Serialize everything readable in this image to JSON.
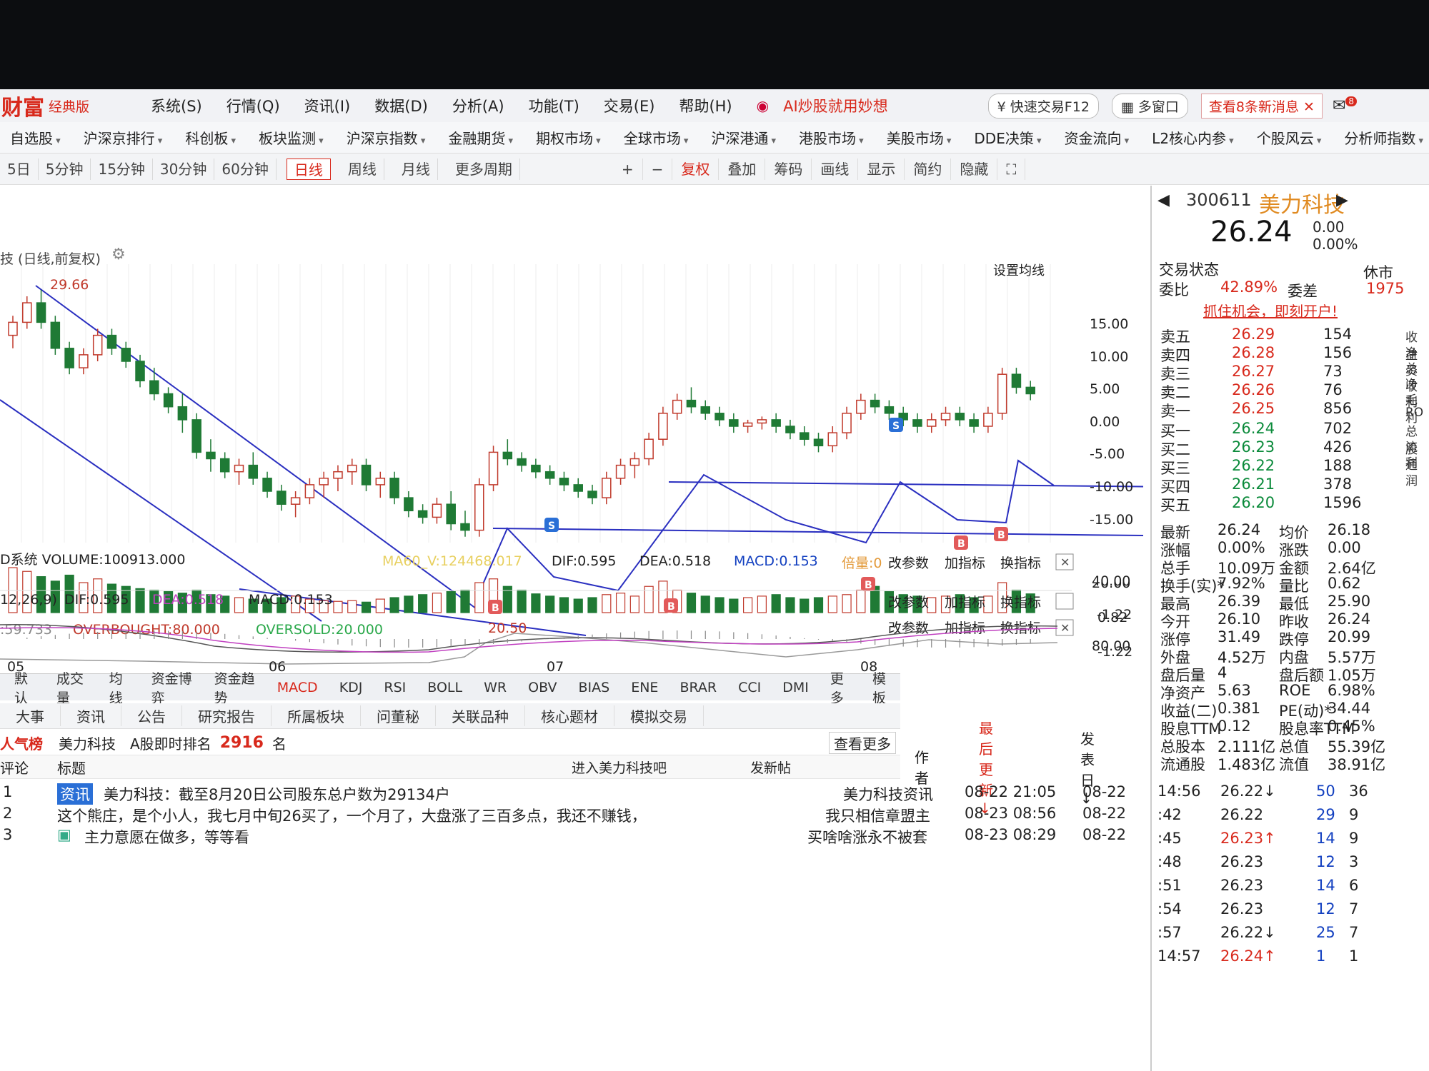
{
  "menu": {
    "logo": "财富",
    "logo_sub": "经典版",
    "items": [
      "系统(S)",
      "行情(Q)",
      "资讯(I)",
      "数据(D)",
      "分析(A)",
      "功能(T)",
      "交易(E)",
      "帮助(H)"
    ],
    "ai": "AI炒股就用妙想",
    "quick": "快速交易F12",
    "multi": "多窗口",
    "news": "查看8条新消息",
    "badge": "8"
  },
  "markets": [
    "自选股",
    "沪深京排行",
    "科创板",
    "板块监测",
    "沪深京指数",
    "金融期货",
    "期权市场",
    "全球市场",
    "沪深港通",
    "港股市场",
    "美股市场",
    "DDE决策",
    "资金流向",
    "L2核心内参",
    "个股风云",
    "分析师指数"
  ],
  "periods": [
    "5日",
    "5分钟",
    "15分钟",
    "30分钟",
    "60分钟",
    "日线",
    "周线",
    "月线",
    "更多周期"
  ],
  "tools": [
    "+",
    "−",
    "复权",
    "叠加",
    "筹码",
    "画线",
    "显示",
    "简约",
    "隐藏"
  ],
  "chart": {
    "title": "技 (日线,前复权)",
    "set_ma": "设置均线",
    "high_mark": "29.66",
    "low_mark": "20.50",
    "yticks": [
      "15.00",
      "10.00",
      "5.00",
      "0.00",
      "-5.00",
      "-10.00",
      "-15.00"
    ],
    "vol_header": "D系统 VOLUME:100913.000",
    "vol_ma": "MA60_V:124468.017",
    "vol_dif": "DIF:0.595",
    "vol_dea": "DEA:0.518",
    "vol_macd": "MACD:0.153",
    "vol_bei": "倍量:0",
    "vol_y": [
      "40.00",
      "-1.22"
    ],
    "rsi_val": ":59.733",
    "overbought": "OVERBOUGHT:80.000",
    "oversold": "OVERSOLD:20.000",
    "rsi_y": [
      "80.00",
      "20.00"
    ],
    "macd_param": "12,26,9)",
    "macd_dif": "DIF:0.595",
    "macd_dea": "DEA:0.518",
    "macd_macd": "MACD:0.153",
    "macd_y": [
      "0.82",
      "-1.22"
    ],
    "panel_btns": [
      "改参数",
      "加指标",
      "换指标"
    ],
    "months": [
      "05",
      "06",
      "07",
      "08"
    ]
  },
  "chart_data": {
    "type": "candlestick",
    "title": "",
    "xlabel": "",
    "ylabel": "",
    "ylim": [
      -17,
      19
    ],
    "annotations": {
      "high": 29.66,
      "low": 20.5,
      "buy_signals": 5,
      "sell_signals": 2
    },
    "candles": [
      [
        14,
        17,
        12,
        16
      ],
      [
        16,
        20,
        15,
        19
      ],
      [
        19,
        21,
        15,
        16
      ],
      [
        16,
        17,
        11,
        12
      ],
      [
        12,
        13,
        8,
        9
      ],
      [
        9,
        12,
        8,
        11
      ],
      [
        11,
        15,
        10,
        14
      ],
      [
        14,
        15,
        11,
        12
      ],
      [
        12,
        13,
        9,
        10
      ],
      [
        10,
        11,
        6,
        7
      ],
      [
        7,
        9,
        4,
        5
      ],
      [
        5,
        6,
        2,
        3
      ],
      [
        3,
        5,
        -1,
        1
      ],
      [
        1,
        2,
        -5,
        -4
      ],
      [
        -4,
        -2,
        -7,
        -5
      ],
      [
        -5,
        -4,
        -8,
        -7
      ],
      [
        -7,
        -5,
        -9,
        -6
      ],
      [
        -6,
        -4,
        -9,
        -8
      ],
      [
        -8,
        -7,
        -11,
        -10
      ],
      [
        -10,
        -9,
        -13,
        -12
      ],
      [
        -12,
        -10,
        -14,
        -11
      ],
      [
        -11,
        -8,
        -12,
        -9
      ],
      [
        -9,
        -7,
        -11,
        -8
      ],
      [
        -8,
        -6,
        -10,
        -7
      ],
      [
        -7,
        -5,
        -9,
        -6
      ],
      [
        -6,
        -5,
        -10,
        -9
      ],
      [
        -9,
        -7,
        -11,
        -8
      ],
      [
        -8,
        -7,
        -12,
        -11
      ],
      [
        -11,
        -10,
        -14,
        -13
      ],
      [
        -13,
        -12,
        -15,
        -14
      ],
      [
        -14,
        -11,
        -15,
        -12
      ],
      [
        -12,
        -10,
        -16,
        -15
      ],
      [
        -15,
        -13,
        -17,
        -16
      ],
      [
        -16,
        -8,
        -17,
        -9
      ],
      [
        -9,
        -3,
        -10,
        -4
      ],
      [
        -4,
        -2,
        -6,
        -5
      ],
      [
        -5,
        -4,
        -7,
        -6
      ],
      [
        -6,
        -5,
        -8,
        -7
      ],
      [
        -7,
        -6,
        -9,
        -8
      ],
      [
        -8,
        -7,
        -10,
        -9
      ],
      [
        -9,
        -8,
        -11,
        -10
      ],
      [
        -10,
        -9,
        -12,
        -11
      ],
      [
        -11,
        -7,
        -12,
        -8
      ],
      [
        -8,
        -5,
        -9,
        -6
      ],
      [
        -6,
        -4,
        -8,
        -5
      ],
      [
        -5,
        -1,
        -6,
        -2
      ],
      [
        -2,
        3,
        -3,
        2
      ],
      [
        2,
        5,
        1,
        4
      ],
      [
        4,
        6,
        2,
        3
      ],
      [
        3,
        4,
        1,
        2
      ],
      [
        2,
        3,
        0,
        1
      ],
      [
        1,
        2,
        -1,
        0
      ],
      [
        0,
        1,
        -1,
        0.5
      ],
      [
        0.5,
        1.5,
        -0.5,
        1
      ],
      [
        1,
        2,
        -1,
        0
      ],
      [
        0,
        1,
        -2,
        -1
      ],
      [
        -1,
        0,
        -3,
        -2
      ],
      [
        -2,
        -1,
        -4,
        -3
      ],
      [
        -3,
        0,
        -4,
        -1
      ],
      [
        -1,
        3,
        -2,
        2
      ],
      [
        2,
        5,
        1,
        4
      ],
      [
        4,
        5,
        2,
        3
      ],
      [
        3,
        4,
        1,
        2
      ],
      [
        2,
        3,
        0,
        1
      ],
      [
        1,
        2,
        -1,
        0
      ],
      [
        0,
        2,
        -1,
        1
      ],
      [
        1,
        3,
        0,
        2
      ],
      [
        2,
        3,
        0,
        1
      ],
      [
        1,
        2,
        -1,
        0
      ],
      [
        0,
        3,
        -1,
        2
      ],
      [
        2,
        9,
        1,
        8
      ],
      [
        8,
        9,
        5,
        6
      ],
      [
        6,
        7,
        4,
        5
      ]
    ],
    "volumes": [
      60,
      55,
      48,
      42,
      50,
      40,
      45,
      38,
      35,
      32,
      30,
      28,
      26,
      30,
      24,
      22,
      20,
      18,
      18,
      20,
      22,
      18,
      16,
      15,
      16,
      14,
      18,
      20,
      22,
      24,
      26,
      28,
      30,
      40,
      45,
      35,
      30,
      25,
      22,
      20,
      18,
      20,
      24,
      26,
      22,
      35,
      42,
      30,
      26,
      22,
      20,
      18,
      20,
      22,
      24,
      20,
      18,
      20,
      22,
      24,
      30,
      35,
      28,
      24,
      22,
      20,
      22,
      24,
      20,
      22,
      40,
      30,
      25
    ]
  },
  "stock": {
    "code": "300611",
    "name": "美力科技",
    "price": "26.24",
    "chg": "0.00",
    "pct": "0.00%",
    "status_label": "交易状态",
    "status": "休市",
    "wb_label": "委比",
    "wb": "42.89%",
    "wc_label": "委差",
    "wc": "1975",
    "promo": "抓住机会，即刻开户!",
    "asks": [
      {
        "l": "卖五",
        "p": "26.29",
        "v": "154"
      },
      {
        "l": "卖四",
        "p": "26.28",
        "v": "156"
      },
      {
        "l": "卖三",
        "p": "26.27",
        "v": "73"
      },
      {
        "l": "卖二",
        "p": "26.26",
        "v": "76"
      },
      {
        "l": "卖一",
        "p": "26.25",
        "v": "856"
      }
    ],
    "bids": [
      {
        "l": "买一",
        "p": "26.24",
        "v": "702"
      },
      {
        "l": "买二",
        "p": "26.23",
        "v": "426"
      },
      {
        "l": "买三",
        "p": "26.22",
        "v": "188"
      },
      {
        "l": "买四",
        "p": "26.21",
        "v": "378"
      },
      {
        "l": "买五",
        "p": "26.20",
        "v": "1596"
      }
    ],
    "stats": [
      [
        "最新",
        "26.24",
        "均价",
        "26.18"
      ],
      [
        "涨幅",
        "0.00%",
        "涨跌",
        "0.00"
      ],
      [
        "总手",
        "10.09万",
        "金额",
        "2.64亿"
      ],
      [
        "换手(实)*",
        "7.92%",
        "量比",
        "0.62"
      ],
      [
        "最高",
        "26.39",
        "最低",
        "25.90"
      ],
      [
        "今开",
        "26.10",
        "昨收",
        "26.24"
      ],
      [
        "涨停",
        "31.49",
        "跌停",
        "20.99"
      ],
      [
        "外盘",
        "4.52万",
        "内盘",
        "5.57万"
      ],
      [
        "盘后量",
        "4",
        "盘后额",
        "1.05万"
      ],
      [
        "净资产",
        "5.63",
        "ROE",
        "6.98%"
      ],
      [
        "收益(二)",
        "0.381",
        "PE(动)*",
        "34.44"
      ],
      [
        "股息TTM",
        "0.12",
        "股息率TTM",
        "0.45%"
      ],
      [
        "总股本",
        "2.111亿",
        "总值",
        "55.39亿"
      ],
      [
        "流通股",
        "1.483亿",
        "流值",
        "38.91亿"
      ]
    ],
    "ticks": [
      [
        "14:56",
        "26.22↓",
        "50",
        "36"
      ],
      [
        ":42",
        "26.22",
        "29",
        "9"
      ],
      [
        ":45",
        "26.23↑",
        "14",
        "9"
      ],
      [
        ":48",
        "26.23",
        "12",
        "3"
      ],
      [
        ":51",
        "26.23",
        "14",
        "6"
      ],
      [
        ":54",
        "26.23",
        "12",
        "7"
      ],
      [
        ":57",
        "26.22↓",
        "25",
        "7"
      ],
      [
        "14:57",
        "26.24↑",
        "1",
        "1"
      ]
    ],
    "edge": [
      "收益",
      "净资",
      "总收",
      "净利",
      "毛利",
      "RO",
      "总股",
      "流通",
      "利润"
    ]
  },
  "bottom_tabs": [
    "默认",
    "成交量",
    "均线",
    "资金博弈",
    "资金趋势",
    "MACD",
    "KDJ",
    "RSI",
    "BOLL",
    "WR",
    "OBV",
    "BIAS",
    "ENE",
    "BRAR",
    "CCI",
    "DMI",
    "更多",
    "模板"
  ],
  "news_tabs": [
    "大事",
    "资讯",
    "公告",
    "研究报告",
    "所属板块",
    "问董秘",
    "关联品种",
    "核心题材",
    "模拟交易"
  ],
  "hot": {
    "label": "人气榜",
    "name": "美力科技",
    "rank_label": "A股即时排名",
    "rank": "2916",
    "unit": "名",
    "more": "查看更多"
  },
  "post_head": {
    "c1": "评论",
    "c2": "标题",
    "enter": "进入美力科技吧",
    "post": "发新帖",
    "author": "作者",
    "updated": "最后更新↓",
    "date": "发表日↓"
  },
  "posts": [
    {
      "n": "1",
      "tag": "资讯",
      "title": "美力科技：截至8月20日公司股东总户数为29134户",
      "author": "美力科技资讯",
      "upd": "08-22 21:05",
      "date": "08-22"
    },
    {
      "n": "2",
      "tag": "",
      "title": "这个熊庄，是个小人，我七月中旬26买了，一个月了，大盘涨了三百多点，我还不赚钱，",
      "author": "我只相信章盟主",
      "upd": "08-23 08:56",
      "date": "08-22"
    },
    {
      "n": "3",
      "tag": "",
      "title": "主力意愿在做多，等等看",
      "author": "买啥啥涨永不被套",
      "upd": "08-23 08:29",
      "date": "08-22"
    }
  ]
}
